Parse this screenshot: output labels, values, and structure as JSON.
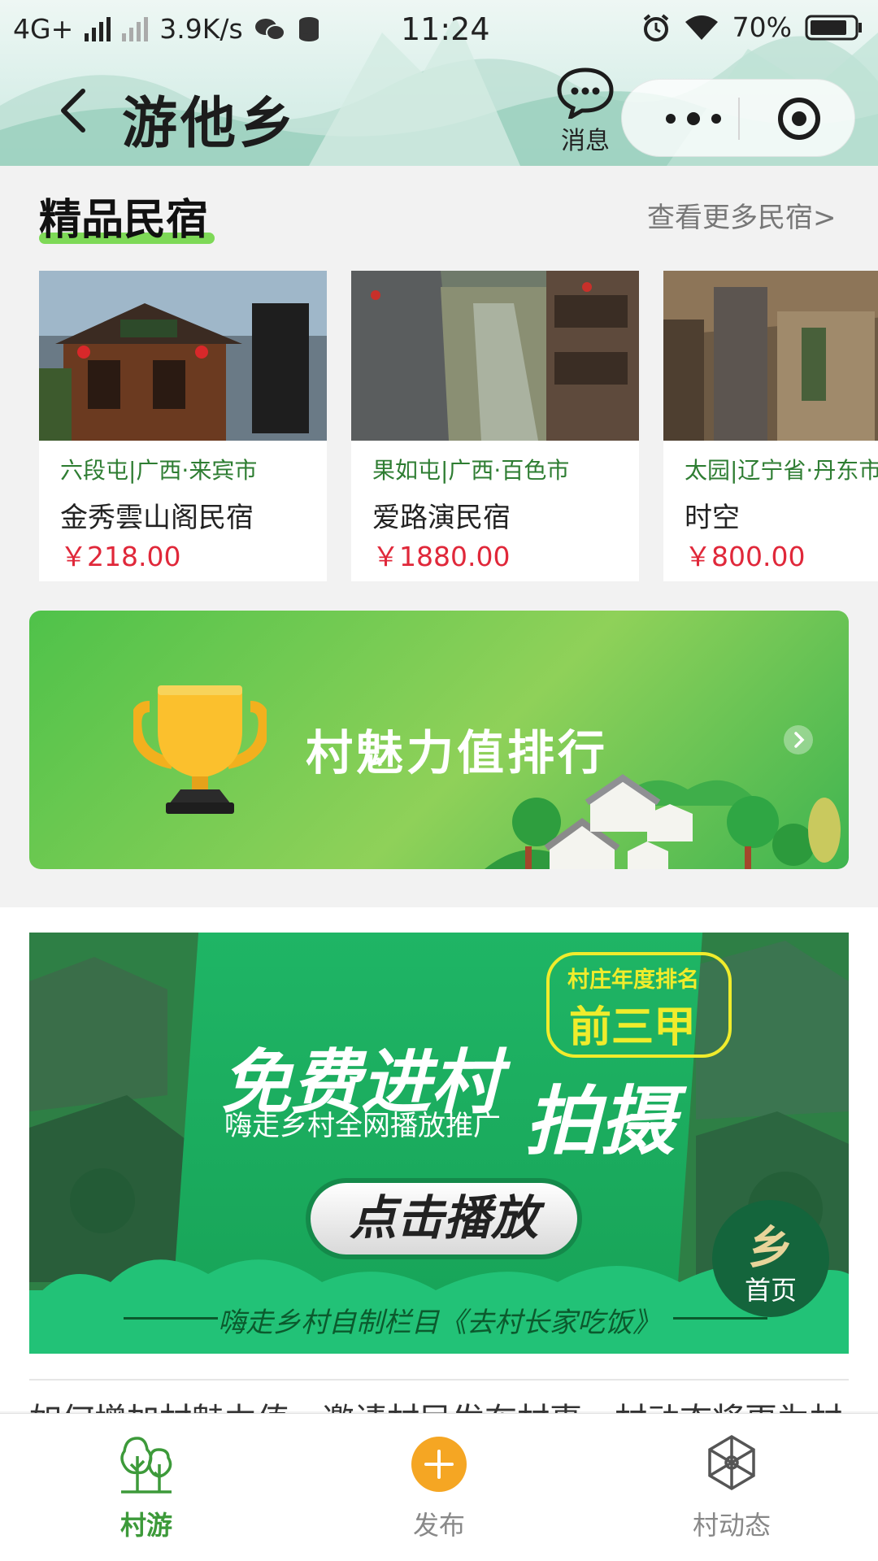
{
  "status_bar": {
    "network": "4G+",
    "speed": "3.9K/s",
    "time": "11:24",
    "battery": "70%"
  },
  "nav": {
    "title": "游他乡",
    "message_label": "消息"
  },
  "section": {
    "title": "精品民宿",
    "more": "查看更多民宿>"
  },
  "homestays": [
    {
      "location": "六段屯|广西·来宾市",
      "name": "金秀雲山阁民宿",
      "price": "￥218.00"
    },
    {
      "location": "果如屯|广西·百色市",
      "name": "爱路演民宿",
      "price": "￥1880.00"
    },
    {
      "location": "太园|辽宁省·丹东市",
      "name": "时空",
      "price": "￥800.00"
    }
  ],
  "ranking_banner": {
    "title": "村魅力值排行"
  },
  "promo_banner": {
    "headline": "免费进村",
    "headline2": "拍摄",
    "subline": "嗨走乡村全网播放推广",
    "bubble_top": "村庄年度排名",
    "bubble_main": "前三甲",
    "play_button": "点击播放",
    "footer": "嗨走乡村自制栏目《去村长家吃饭》"
  },
  "home_fab": {
    "glyph": "乡",
    "label": "首页"
  },
  "partial_text": "如何增加村魅力值，邀请村民发布村事，村动态将更为村",
  "tabs": [
    {
      "label": "村游",
      "icon": "tree-icon",
      "active": true
    },
    {
      "label": "发布",
      "icon": "plus-circle-icon",
      "active": false
    },
    {
      "label": "村动态",
      "icon": "wheel-icon",
      "active": false
    }
  ],
  "colors": {
    "brand_green": "#3d9a3a",
    "price_red": "#e0283a",
    "accent_yellow": "#f5a623"
  }
}
